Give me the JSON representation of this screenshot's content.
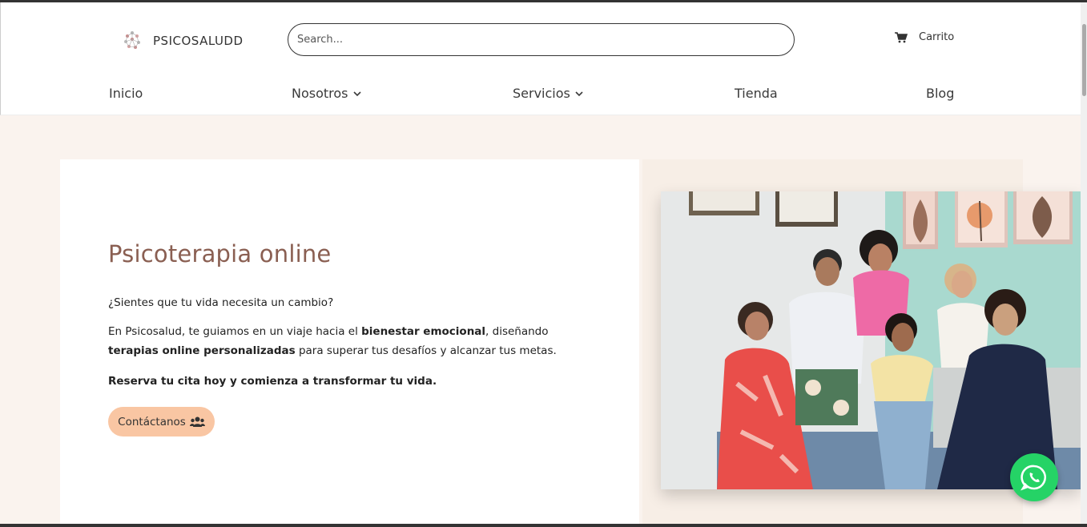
{
  "brand": {
    "name": "PSICOSALUDD"
  },
  "search": {
    "placeholder": "Search..."
  },
  "cart": {
    "label": "Carrito"
  },
  "nav": {
    "items": [
      {
        "label": "Inicio"
      },
      {
        "label": "Nosotros"
      },
      {
        "label": "Servicios"
      },
      {
        "label": "Tienda"
      },
      {
        "label": "Blog"
      }
    ]
  },
  "hero": {
    "title": "Psicoterapia online",
    "question": "¿Sientes que tu vida necesita un cambio?",
    "intro_1": "En Psicosalud, te guiamos en un viaje hacia el ",
    "intro_bold_1": "bienestar emocional",
    "intro_2": ", diseñando",
    "intro_bold_2": "terapias online personalizadas",
    "intro_3": " para superar tus desafíos y alcanzar tus metas.",
    "cta_text": "Reserva tu cita hoy y comienza a transformar tu vida.",
    "button_label": "Contáctanos"
  },
  "colors": {
    "title": "#8a5f52",
    "button": "#f9c6a3",
    "page_bg": "#faf3ee",
    "whatsapp": "#25d366"
  }
}
